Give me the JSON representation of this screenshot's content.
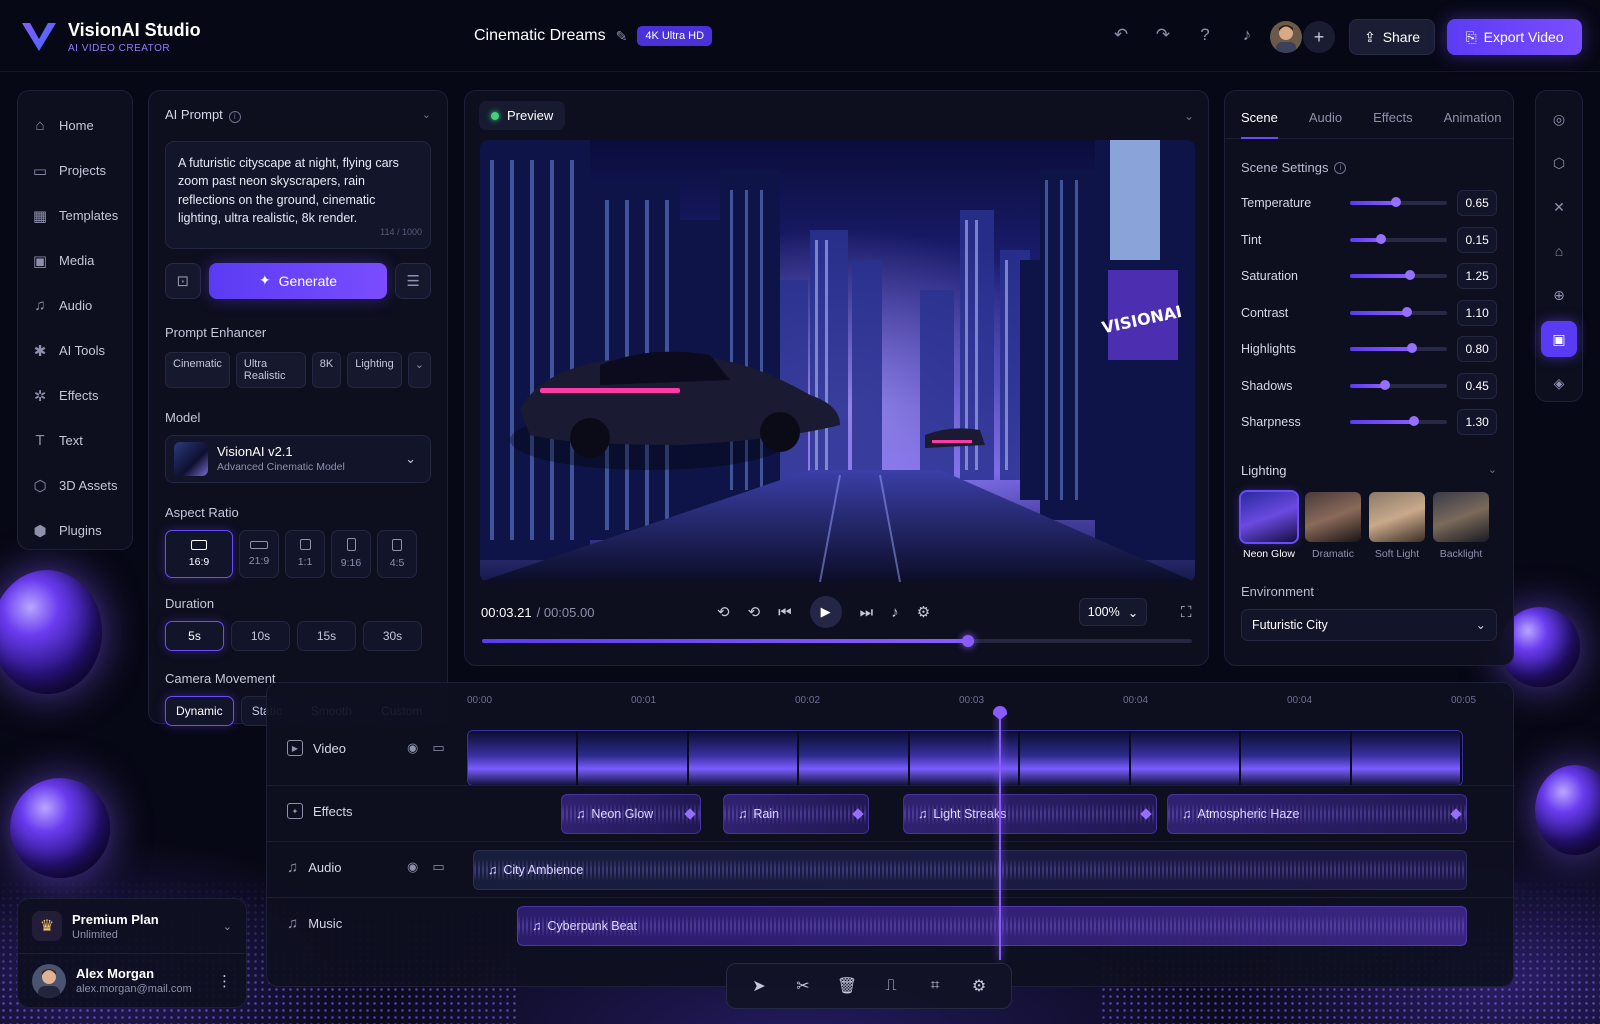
{
  "app": {
    "name": "VisionAI Studio",
    "tagline": "AI VIDEO CREATOR"
  },
  "project": {
    "title": "Cinematic Dreams",
    "badge": "4K Ultra HD"
  },
  "header": {
    "share_label": "Share",
    "export_label": "Export Video"
  },
  "nav": {
    "items": [
      {
        "label": "Home",
        "icon": "home-icon"
      },
      {
        "label": "Projects",
        "icon": "folder-icon"
      },
      {
        "label": "Templates",
        "icon": "templates-icon"
      },
      {
        "label": "Media",
        "icon": "media-icon"
      },
      {
        "label": "Audio",
        "icon": "music-note-icon"
      },
      {
        "label": "AI Tools",
        "icon": "ai-tools-icon"
      },
      {
        "label": "Effects",
        "icon": "effects-icon"
      },
      {
        "label": "Text",
        "icon": "text-icon"
      },
      {
        "label": "3D Assets",
        "icon": "cube-icon"
      },
      {
        "label": "Plugins",
        "icon": "plugin-icon"
      }
    ]
  },
  "plan": {
    "name": "Premium Plan",
    "detail": "Unlimited"
  },
  "user": {
    "name": "Alex Morgan",
    "email": "alex.morgan@mail.com"
  },
  "prompt": {
    "title": "AI Prompt",
    "text": "A futuristic cityscape at night, flying cars zoom past neon skyscrapers, rain reflections on the ground, cinematic lighting, ultra realistic, 8k render.",
    "char_count": "114 / 1000",
    "generate_label": "Generate",
    "enhancer_label": "Prompt Enhancer",
    "enhancer_chips": [
      "Cinematic",
      "Ultra Realistic",
      "8K",
      "Lighting"
    ],
    "model_label": "Model",
    "model_name": "VisionAI v2.1",
    "model_desc": "Advanced Cinematic Model",
    "aspect_label": "Aspect Ratio",
    "aspects": [
      "16:9",
      "21:9",
      "1:1",
      "9:16",
      "4:5"
    ],
    "aspect_selected": "16:9",
    "duration_label": "Duration",
    "durations": [
      "5s",
      "10s",
      "15s",
      "30s"
    ],
    "duration_selected": "5s",
    "camera_label": "Camera Movement",
    "camera_options": [
      "Dynamic",
      "Static",
      "Smooth",
      "Custom"
    ],
    "camera_selected": "Dynamic"
  },
  "preview": {
    "label": "Preview",
    "sign_text": "VISIONAI",
    "time_current": "00:03.21",
    "time_total": "/ 00:05.00",
    "zoom": "100%",
    "progress_fraction": 0.685
  },
  "scene": {
    "tabs": [
      "Scene",
      "Audio",
      "Effects",
      "Animation"
    ],
    "active_tab": "Scene",
    "settings_label": "Scene Settings",
    "sliders": [
      {
        "label": "Temperature",
        "value": "0.65",
        "fraction": 0.47
      },
      {
        "label": "Tint",
        "value": "0.15",
        "fraction": 0.32
      },
      {
        "label": "Saturation",
        "value": "1.25",
        "fraction": 0.62
      },
      {
        "label": "Contrast",
        "value": "1.10",
        "fraction": 0.59
      },
      {
        "label": "Highlights",
        "value": "0.80",
        "fraction": 0.64
      },
      {
        "label": "Shadows",
        "value": "0.45",
        "fraction": 0.36
      },
      {
        "label": "Sharpness",
        "value": "1.30",
        "fraction": 0.66
      }
    ],
    "lighting_label": "Lighting",
    "lighting": [
      "Neon Glow",
      "Dramatic",
      "Soft Light",
      "Backlight"
    ],
    "lighting_selected": "Neon Glow",
    "environment_label": "Environment",
    "environment_value": "Futuristic City"
  },
  "timeline": {
    "ruler": [
      "00:00",
      "00:01",
      "00:02",
      "00:03",
      "00:04",
      "00:04",
      "00:05"
    ],
    "tracks": [
      {
        "name": "Video"
      },
      {
        "name": "Effects"
      },
      {
        "name": "Audio"
      },
      {
        "name": "Music"
      }
    ],
    "effects_clips": [
      "Neon Glow",
      "Rain",
      "Light Streaks",
      "Atmospheric Haze"
    ],
    "audio_clip": "City Ambience",
    "music_clip": "Cyberpunk Beat"
  },
  "colors": {
    "accent": "#6a4cff",
    "accent_light": "#8a5cff",
    "bg": "#070815",
    "panel": "#0e0f20",
    "live": "#3fd37a"
  }
}
